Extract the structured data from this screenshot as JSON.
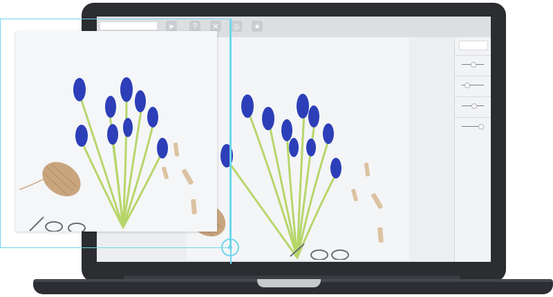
{
  "app": {
    "toolbar": {
      "url_field_value": "",
      "icons": [
        "send-icon",
        "help-icon",
        "close-icon",
        "settings-icon",
        "star-icon"
      ],
      "icon_glyphs": [
        "➤",
        "?",
        "✕",
        "◎",
        "★"
      ]
    },
    "right_panel": {
      "field_value": "",
      "slider_levels": [
        0.5,
        0.2,
        0.55,
        0.85
      ]
    }
  },
  "colors": {
    "laptop_body": "#2b2d31",
    "screen_bg": "#eceef0",
    "toolbar_bg": "#dcdee1",
    "accent_cyan": "#6fd6ec",
    "flower_blue": "#2d3fb8",
    "stem_green": "#b7d66a",
    "twine": "#c9a57e"
  }
}
